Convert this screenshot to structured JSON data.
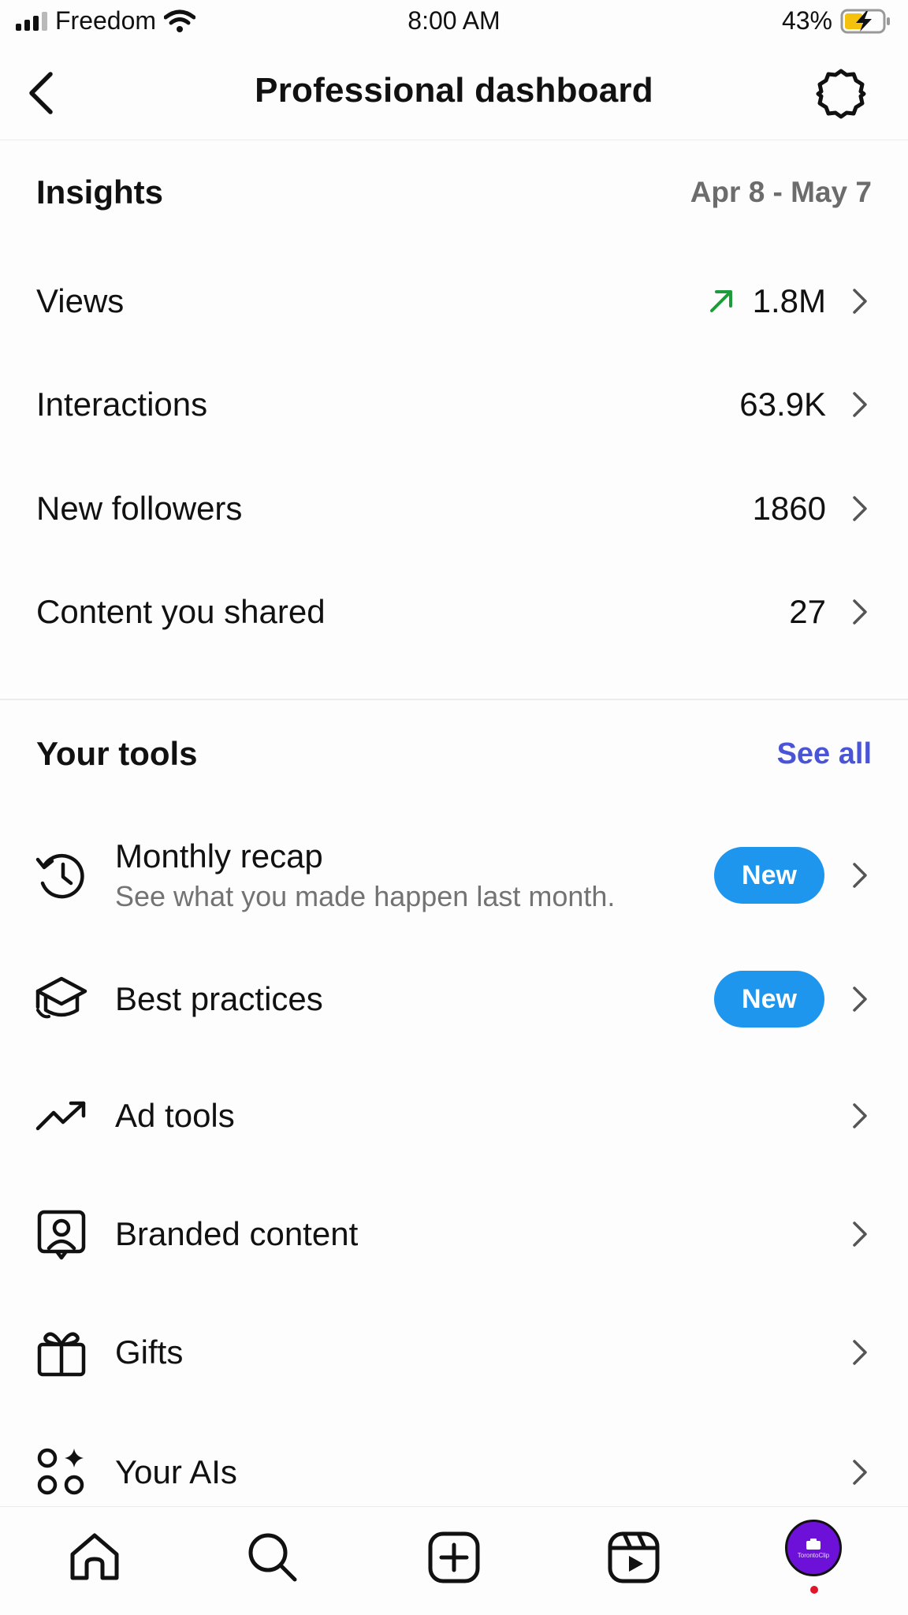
{
  "status_bar": {
    "carrier": "Freedom",
    "time": "8:00 AM",
    "battery": "43%",
    "icons": [
      "signal-icon",
      "wifi-icon",
      "battery-charging-icon"
    ]
  },
  "header": {
    "title": "Professional dashboard",
    "back_icon": "back-chevron-icon",
    "settings_icon": "gear-icon"
  },
  "insights": {
    "title": "Insights",
    "date_range": "Apr 8 - May 7",
    "metrics": [
      {
        "label": "Views",
        "value": "1.8M",
        "trend": "up-arrow-icon",
        "trend_color": "#1e9b3a"
      },
      {
        "label": "Interactions",
        "value": "63.9K"
      },
      {
        "label": "New followers",
        "value": "1860"
      },
      {
        "label": "Content you shared",
        "value": "27"
      }
    ]
  },
  "tools": {
    "title": "Your tools",
    "see_all": "See all",
    "items": [
      {
        "label": "Monthly recap",
        "sub": "See what you made happen last month.",
        "badge": "New",
        "icon": "history-clock-icon"
      },
      {
        "label": "Best practices",
        "badge": "New",
        "icon": "graduation-cap-icon"
      },
      {
        "label": "Ad tools",
        "icon": "trending-up-icon"
      },
      {
        "label": "Branded content",
        "icon": "branded-content-icon"
      },
      {
        "label": "Gifts",
        "icon": "gift-icon"
      },
      {
        "label": "Your AIs",
        "icon": "ai-circles-icon"
      }
    ]
  },
  "bottom_nav": {
    "items": [
      "home-icon",
      "search-icon",
      "create-icon",
      "reels-icon",
      "profile-avatar"
    ],
    "avatar_text": "TorontoClip",
    "colors": {
      "avatar_bg": "#6d11d9",
      "notification_dot": "#e0142a"
    }
  },
  "colors": {
    "accent_link": "#4a55d6",
    "badge_bg": "#1f96ee"
  }
}
